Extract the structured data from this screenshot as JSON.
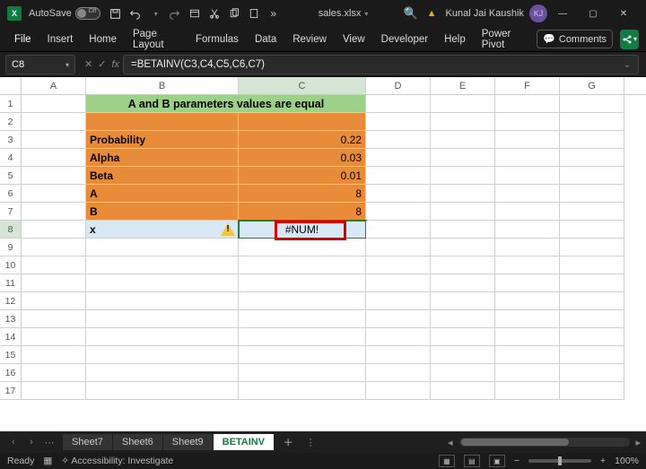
{
  "titlebar": {
    "autosave_label": "AutoSave",
    "autosave_state": "Off",
    "filename": "sales.xlsx",
    "user_name": "Kunal Jai Kaushik",
    "user_initials": "KJ"
  },
  "ribbon": {
    "tabs": [
      "File",
      "Insert",
      "Home",
      "Page Layout",
      "Formulas",
      "Data",
      "Review",
      "View",
      "Developer",
      "Help",
      "Power Pivot"
    ],
    "comments_label": "Comments"
  },
  "formulabar": {
    "cell_ref": "C8",
    "formula": "=BETAINV(C3,C4,C5,C6,C7)"
  },
  "columns": [
    "A",
    "B",
    "C",
    "D",
    "E",
    "F",
    "G"
  ],
  "rows_visible": 16,
  "sheet": {
    "header_text": "A and B parameters values are equal",
    "labels": {
      "r3": "Probability",
      "r4": "Alpha",
      "r5": "Beta",
      "r6": "A",
      "r7": "B",
      "r8": "x"
    },
    "values": {
      "r3": "0.22",
      "r4": "0.03",
      "r5": "0.01",
      "r6": "8",
      "r7": "8",
      "r8": "#NUM!"
    }
  },
  "sheet_tabs": {
    "items": [
      "Sheet7",
      "Sheet6",
      "Sheet9",
      "BETAINV"
    ],
    "active": "BETAINV"
  },
  "statusbar": {
    "ready": "Ready",
    "accessibility": "Accessibility: Investigate",
    "zoom": "100%"
  }
}
